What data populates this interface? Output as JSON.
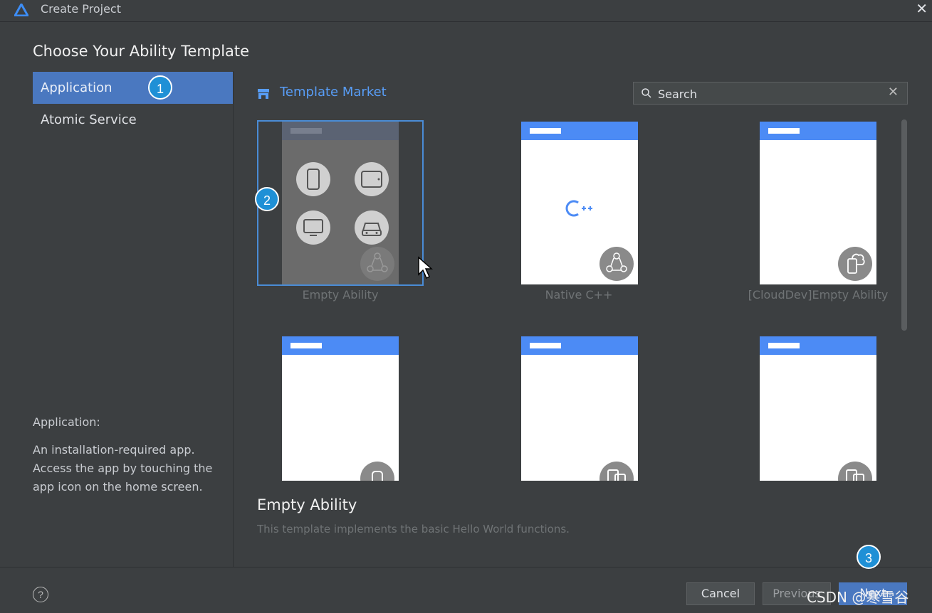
{
  "window": {
    "title": "Create Project"
  },
  "heading": "Choose Your Ability Template",
  "sidebar": {
    "items": [
      {
        "label": "Application",
        "selected": true
      },
      {
        "label": "Atomic Service",
        "selected": false
      }
    ],
    "description_title": "Application:",
    "description_body": "An installation-required app. Access the app by touching the app icon on the home screen."
  },
  "badges": [
    "1",
    "2",
    "3"
  ],
  "market": {
    "label": "Template Market"
  },
  "search": {
    "placeholder": "Search"
  },
  "templates": [
    {
      "label": "Empty Ability",
      "selected": true
    },
    {
      "label": "Native C++",
      "selected": false
    },
    {
      "label": "[CloudDev]Empty Ability",
      "selected": false
    },
    {
      "label": "",
      "selected": false
    },
    {
      "label": "",
      "selected": false
    },
    {
      "label": "",
      "selected": false
    }
  ],
  "detail": {
    "title": "Empty Ability",
    "description": "This template implements the basic Hello World functions."
  },
  "footer": {
    "cancel_label": "Cancel",
    "previous_label": "Previous",
    "next_label": "Next"
  },
  "watermark": "CSDN @寒雪谷",
  "colors": {
    "accent": "#4a78c0",
    "link": "#589df6",
    "card_header": "#4c8bf5",
    "badge": "#1f90d6"
  }
}
